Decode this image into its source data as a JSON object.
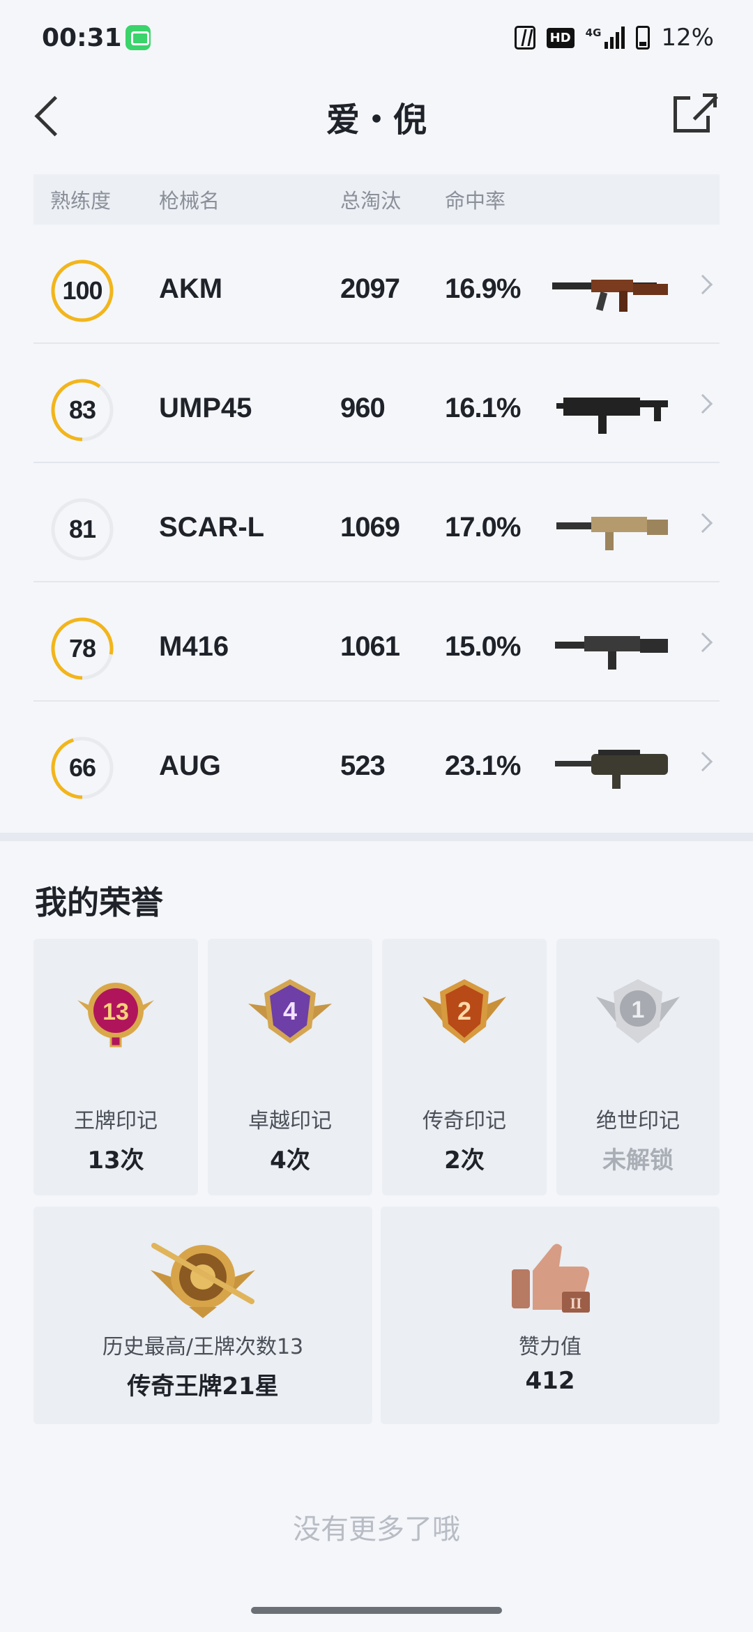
{
  "status_bar": {
    "time": "00:31",
    "network": "4G",
    "battery": "12%"
  },
  "header": {
    "title": "爱・倪"
  },
  "table": {
    "columns": [
      "熟练度",
      "枪械名",
      "总淘汰",
      "命中率"
    ],
    "rows": [
      {
        "proficiency": "100",
        "proficiency_fraction": 1.0,
        "name": "AKM",
        "kills": "2097",
        "hit_rate": "16.9%"
      },
      {
        "proficiency": "83",
        "proficiency_fraction": 0.6,
        "name": "UMP45",
        "kills": "960",
        "hit_rate": "16.1%"
      },
      {
        "proficiency": "81",
        "proficiency_fraction": 0.0,
        "name": "SCAR-L",
        "kills": "1069",
        "hit_rate": "17.0%"
      },
      {
        "proficiency": "78",
        "proficiency_fraction": 0.78,
        "name": "M416",
        "kills": "1061",
        "hit_rate": "15.0%"
      },
      {
        "proficiency": "66",
        "proficiency_fraction": 0.45,
        "name": "AUG",
        "kills": "523",
        "hit_rate": "23.1%"
      }
    ]
  },
  "honors": {
    "title": "我的荣誉",
    "marks": [
      {
        "badge": "13",
        "label": "王牌印记",
        "value": "13次"
      },
      {
        "badge": "4",
        "label": "卓越印记",
        "value": "4次"
      },
      {
        "badge": "2",
        "label": "传奇印记",
        "value": "2次"
      },
      {
        "badge": "1",
        "label": "绝世印记",
        "value": "未解锁"
      }
    ],
    "best": {
      "label": "历史最高/王牌次数13",
      "value": "传奇王牌21星"
    },
    "likes": {
      "label": "赞力值",
      "value": "412"
    }
  },
  "footer": {
    "note": "没有更多了哦"
  },
  "colors": {
    "ring_accent": "#f2b51b",
    "ring_track": "#e8eaee"
  }
}
